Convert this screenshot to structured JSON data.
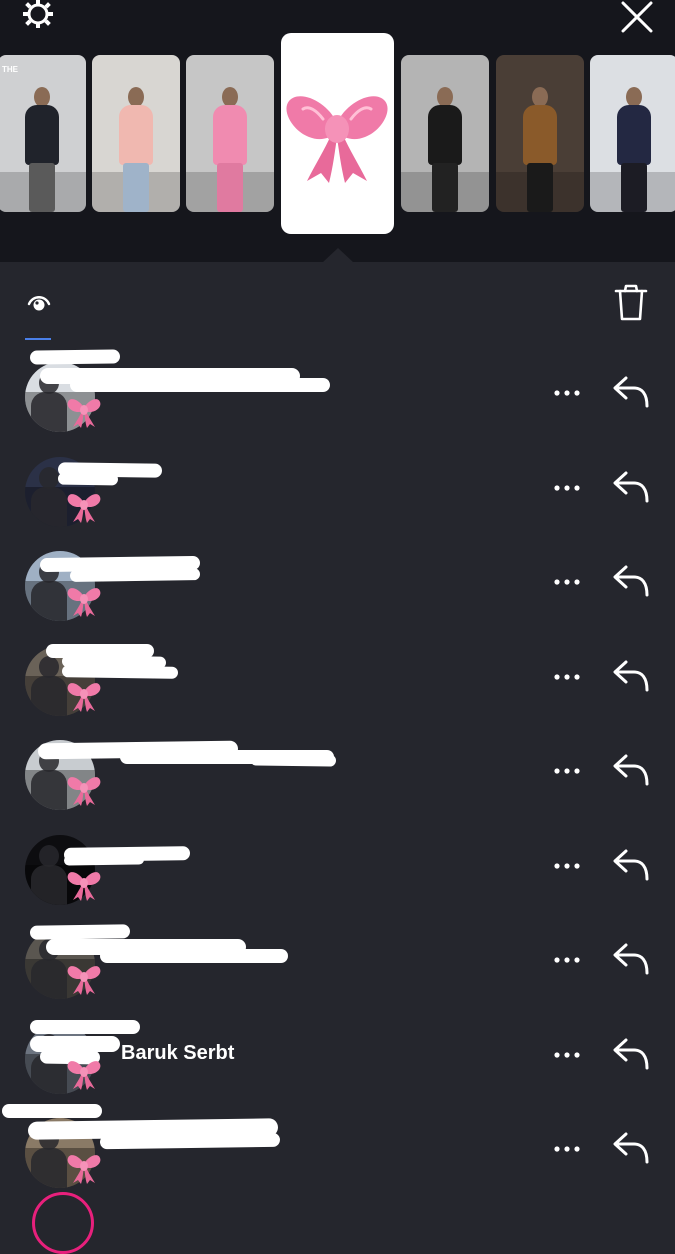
{
  "header": {
    "settings_icon": "gear-icon",
    "close_icon": "close-icon"
  },
  "story_strip": {
    "thumbnails": [
      {
        "label": "THE",
        "bg": "#cfd0d2",
        "top": "#20232b",
        "bottom": "#5a5a5a"
      },
      {
        "label": "",
        "bg": "#d8d6d2",
        "top": "#f0b8b0",
        "bottom": "#9fb3c9"
      },
      {
        "label": "",
        "bg": "#c6c6c6",
        "top": "#f08bb0",
        "bottom": "#e07aa0"
      },
      {
        "label": "",
        "bg": "#b4b4b4",
        "top": "#1a1a1a",
        "bottom": "#222222"
      },
      {
        "label": "",
        "bg": "#4a3e36",
        "top": "#8a5a2a",
        "bottom": "#1a1a1a"
      },
      {
        "label": "",
        "bg": "#dcdfe3",
        "top": "#232842",
        "bottom": "#1c1c24"
      }
    ],
    "selected_icon": "pink-bow-icon"
  },
  "viewer_panel": {
    "eye_icon": "eye-icon",
    "trash_icon": "trash-icon",
    "rows": [
      {
        "name": "",
        "avatar_bg": "#d9dde2",
        "redactions": [
          [
            30,
            -4,
            90,
            14
          ],
          [
            40,
            14,
            260,
            16
          ],
          [
            70,
            24,
            260,
            14
          ]
        ]
      },
      {
        "name": "",
        "avatar_bg": "#2b3147",
        "redactions": [
          [
            58,
            14,
            104,
            14
          ],
          [
            58,
            24,
            60,
            12
          ]
        ]
      },
      {
        "name": "",
        "avatar_bg": "#9fb0c4",
        "redactions": [
          [
            40,
            14,
            160,
            14
          ],
          [
            70,
            26,
            130,
            12
          ]
        ]
      },
      {
        "name": "",
        "avatar_bg": "#6a6258",
        "redactions": [
          [
            46,
            6,
            108,
            14
          ],
          [
            62,
            18,
            104,
            12
          ],
          [
            62,
            28,
            116,
            12
          ]
        ]
      },
      {
        "name": "",
        "avatar_bg": "#c8ccd0",
        "redactions": [
          [
            38,
            10,
            200,
            16
          ],
          [
            120,
            18,
            214,
            14
          ],
          [
            250,
            22,
            86,
            12
          ]
        ]
      },
      {
        "name": "",
        "avatar_bg": "#0d0d10",
        "redactions": [
          [
            64,
            20,
            126,
            14
          ],
          [
            64,
            28,
            80,
            10
          ]
        ]
      },
      {
        "name": "",
        "avatar_bg": "#5a5650",
        "redactions": [
          [
            30,
            4,
            100,
            14
          ],
          [
            46,
            18,
            200,
            16
          ],
          [
            100,
            28,
            188,
            14
          ]
        ]
      },
      {
        "name": "Baruk Serbt",
        "avatar_bg": "#6c7480",
        "redactions": [
          [
            30,
            4,
            110,
            14
          ],
          [
            30,
            20,
            90,
            16
          ],
          [
            40,
            34,
            60,
            14
          ]
        ]
      },
      {
        "name": "",
        "avatar_bg": "#8a7a66",
        "redactions": [
          [
            2,
            -6,
            100,
            14
          ],
          [
            28,
            10,
            250,
            18
          ],
          [
            100,
            24,
            180,
            14
          ]
        ]
      }
    ],
    "more_icon": "more-icon",
    "reply_icon": "reply-icon"
  },
  "colors": {
    "top_bg": "#15161c",
    "panel_bg": "#25262d",
    "accent_blue": "#4a7fe8",
    "bow_pink": "#f07aa8",
    "ring_pink": "#e8207c"
  }
}
